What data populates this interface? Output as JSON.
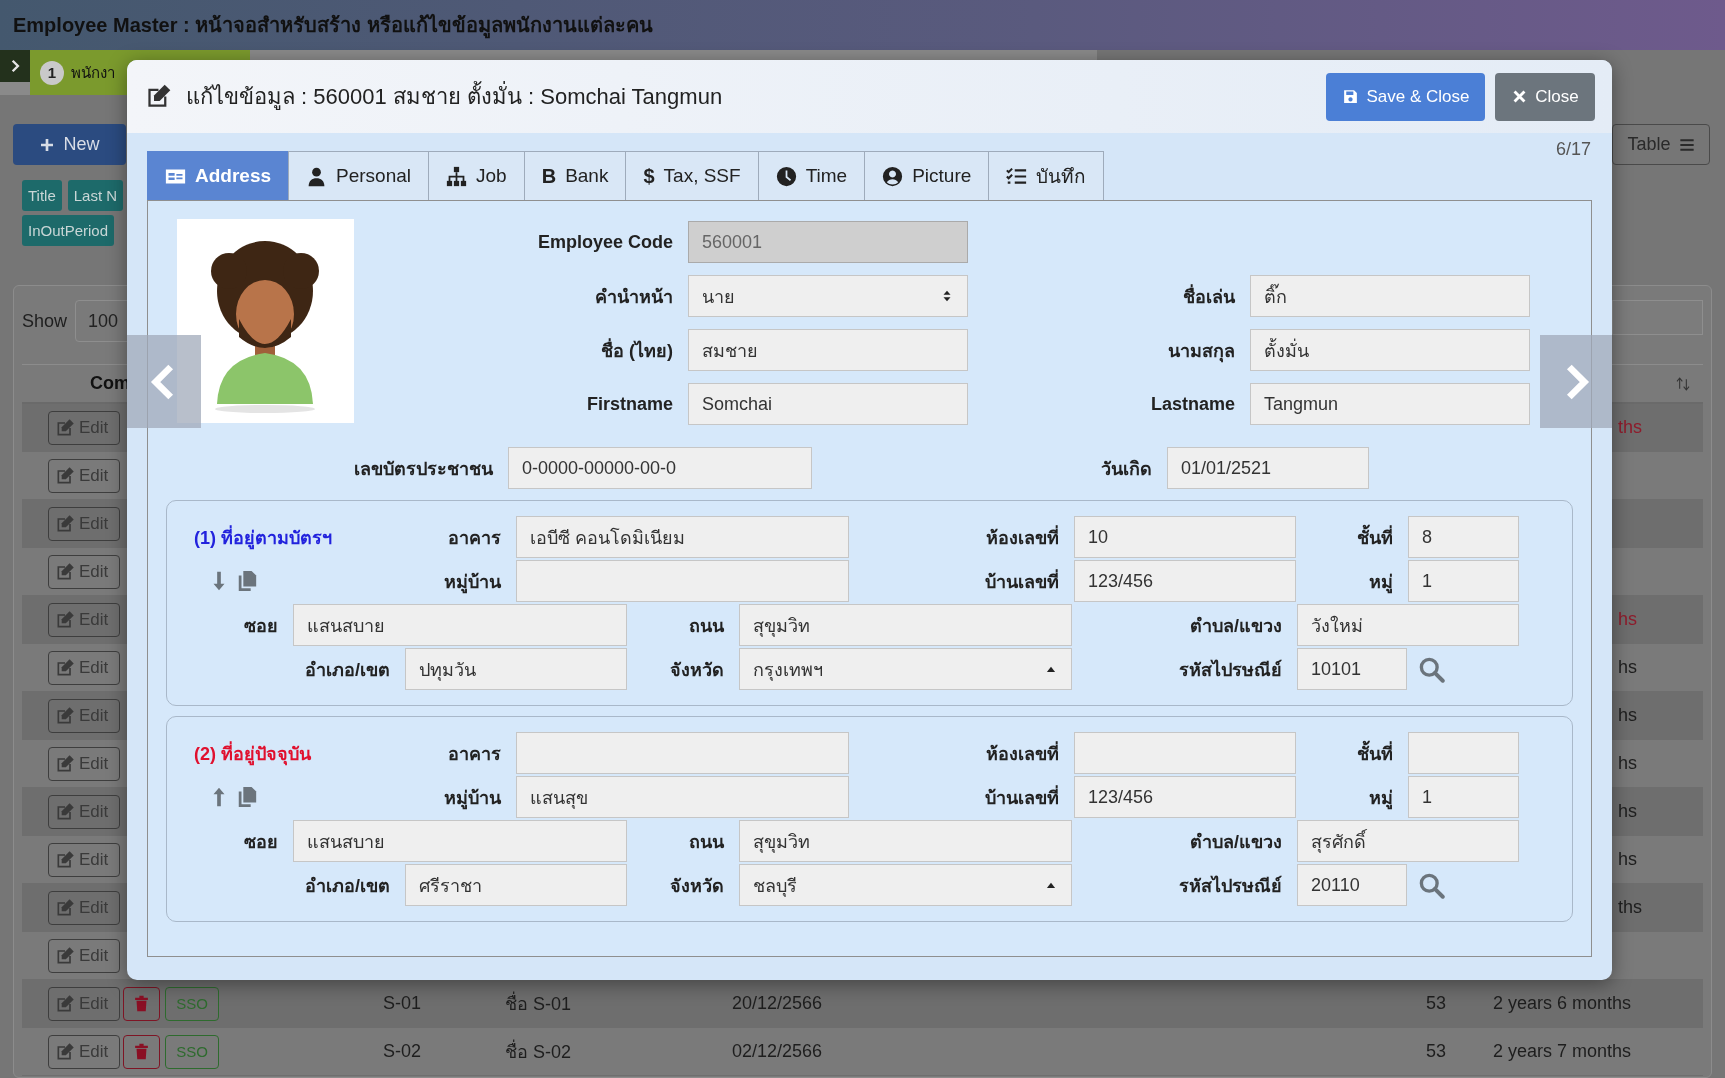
{
  "page": {
    "title": "Employee Master : หน้าจอสำหรับสร้าง หรือแก้ไขข้อมูลพนักงานแต่ละคน"
  },
  "steps": [
    {
      "number": "1",
      "label": "พนักงา",
      "selected": true
    }
  ],
  "toolbar": {
    "new_button": "New",
    "view_button": "Table"
  },
  "filter_tag_rows": [
    [
      "Title",
      "Last N"
    ],
    [
      "InOutPeriod"
    ]
  ],
  "table_controls": {
    "show_label": "Show",
    "page_size": "100"
  },
  "table": {
    "columns": [
      {
        "label": "Com"
      }
    ],
    "rows": [
      {
        "edit": "Edit",
        "years": "ths",
        "color": "#8e1c2c"
      },
      {
        "edit": "Edit"
      },
      {
        "edit": "Edit"
      },
      {
        "edit": "Edit"
      },
      {
        "edit": "Edit",
        "years": "hs",
        "color": "#8e1c2c"
      },
      {
        "edit": "Edit",
        "years": "hs",
        "color": "#1e1e1e"
      },
      {
        "edit": "Edit",
        "years": "hs",
        "color": "#1e1e1e"
      },
      {
        "edit": "Edit",
        "years": "hs",
        "color": "#1e1e1e"
      },
      {
        "edit": "Edit",
        "years": "hs",
        "color": "#1e1e1e"
      },
      {
        "edit": "Edit",
        "years": "hs",
        "color": "#1e1e1e"
      },
      {
        "edit": "Edit",
        "years": "ths",
        "color": "#1e1e1e"
      },
      {
        "edit": "Edit"
      },
      {
        "edit": "Edit",
        "delete": true,
        "sso": "SSO",
        "code": "S-01",
        "name": "ชื่อ S-01",
        "date": "20/12/2566",
        "age": "53",
        "years": "2 years 6 months",
        "color": "#1e1e1e"
      },
      {
        "edit": "Edit",
        "delete": true,
        "sso": "SSO",
        "code": "S-02",
        "name": "ชื่อ S-02",
        "date": "02/12/2566",
        "age": "53",
        "years": "2 years 7 months",
        "color": "#1e1e1e"
      }
    ]
  },
  "modal": {
    "title": "แก้ไขข้อมูล : 560001 สมชาย ตั้งมั่น : Somchai Tangmun",
    "save_button": "Save & Close",
    "close_button": "Close",
    "counter": "6/17",
    "tabs": [
      {
        "label": "Address",
        "selected": true
      },
      {
        "label": "Personal",
        "selected": false
      },
      {
        "label": "Job",
        "selected": false
      },
      {
        "label": "Bank",
        "glyph": "B",
        "selected": false
      },
      {
        "label": "Tax, SSF",
        "glyph": "$",
        "selected": false
      },
      {
        "label": "Time",
        "selected": false
      },
      {
        "label": "Picture",
        "selected": false
      },
      {
        "label": "บันทึก",
        "selected": false
      }
    ],
    "photo": {
      "kind": "picture"
    },
    "top_rows": [
      [
        {
          "label": "Employee Code",
          "value": "560001",
          "kind": "text",
          "disabled": true
        }
      ],
      [
        {
          "label": "คำนำหน้า",
          "value": "นาย",
          "kind": "select",
          "disabled": false
        },
        {
          "label": "ชื่อเล่น",
          "value": "ติ๊ก",
          "kind": "text",
          "disabled": false
        }
      ],
      [
        {
          "label": "ชื่อ (ไทย)",
          "value": "สมชาย",
          "kind": "text",
          "disabled": false
        },
        {
          "label": "นามสกุล",
          "value": "ตั้งมั่น",
          "kind": "text",
          "disabled": false
        }
      ],
      [
        {
          "label": "Firstname",
          "value": "Somchai",
          "kind": "text",
          "disabled": false
        },
        {
          "label": "Lastname",
          "value": "Tangmun",
          "kind": "text",
          "disabled": false
        }
      ]
    ],
    "id_row": [
      {
        "label": "เลขบัตรประชาชน",
        "value": "0-0000-00000-00-0",
        "kind": "text",
        "disabled": false
      },
      {
        "label": "วันเกิด",
        "value": "01/01/2521",
        "kind": "text",
        "disabled": false
      }
    ],
    "addresses": [
      {
        "title": "(1) ที่อยู่ตามบัตรฯ",
        "color": "#2222dd",
        "fields": [
          {
            "label": "อาคาร",
            "value": "เอบีซี คอนโดมิเนียม",
            "kind": "text"
          },
          {
            "label": "ห้องเลขที่",
            "value": "10",
            "kind": "text"
          },
          {
            "label": "ชั้นที่",
            "value": "8",
            "kind": "text"
          },
          {
            "label": "หมู่บ้าน",
            "kind": "text"
          },
          {
            "label": "บ้านเลขที่",
            "value": "123/456",
            "kind": "text"
          },
          {
            "label": "หมู่",
            "value": "1",
            "kind": "text"
          },
          {
            "label": "ซอย",
            "value": "แสนสบาย",
            "kind": "text"
          },
          {
            "label": "ถนน",
            "value": "สุขุมวิท",
            "kind": "text"
          },
          {
            "label": "ตำบล/แขวง",
            "value": "วังใหม่",
            "kind": "text"
          },
          {
            "label": "อำเภอ/เขต",
            "value": "ปทุมวัน",
            "kind": "text"
          },
          {
            "label": "จังหวัด",
            "value": "กรุงเทพฯ",
            "kind": "select"
          },
          {
            "label": "รหัสไปรษณีย์",
            "value": "10101",
            "kind": "text"
          }
        ]
      },
      {
        "title": "(2) ที่อยู่ปัจจุบัน",
        "color": "#e0102e",
        "fields": [
          {
            "label": "อาคาร",
            "kind": "text"
          },
          {
            "label": "ห้องเลขที่",
            "kind": "text"
          },
          {
            "label": "ชั้นที่",
            "kind": "text"
          },
          {
            "label": "หมู่บ้าน",
            "value": "แสนสุข",
            "kind": "text"
          },
          {
            "label": "บ้านเลขที่",
            "value": "123/456",
            "kind": "text"
          },
          {
            "label": "หมู่",
            "value": "1",
            "kind": "text"
          },
          {
            "label": "ซอย",
            "value": "แสนสบาย",
            "kind": "text"
          },
          {
            "label": "ถนน",
            "value": "สุขุมวิท",
            "kind": "text"
          },
          {
            "label": "ตำบล/แขวง",
            "value": "สุรศักดิ์",
            "kind": "text"
          },
          {
            "label": "อำเภอ/เขต",
            "value": "ศรีราชา",
            "kind": "text"
          },
          {
            "label": "จังหวัด",
            "value": "ชลบุรี",
            "kind": "select"
          },
          {
            "label": "รหัสไปรษณีย์",
            "value": "20110",
            "kind": "text"
          }
        ]
      }
    ]
  }
}
